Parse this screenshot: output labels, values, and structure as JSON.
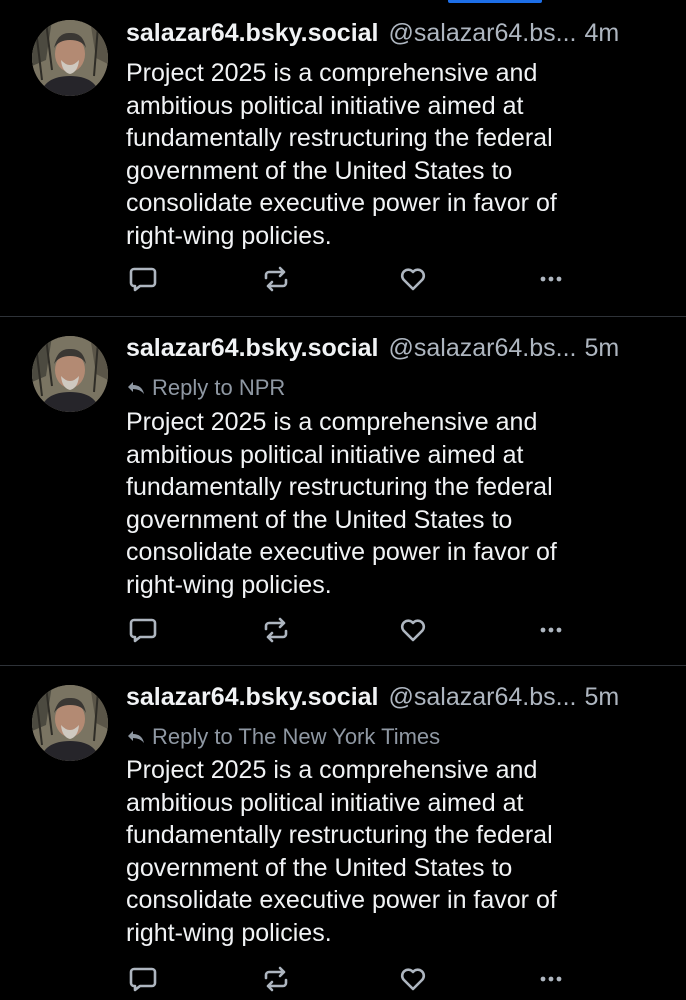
{
  "theme": {
    "background": "#000000",
    "text": "#f1f3f5",
    "muted": "#aeb6c0",
    "divider": "#2e3238",
    "accent": "#1d6fe8"
  },
  "icons": {
    "reply": "speech-bubble-icon",
    "repost": "repost-arrows-icon",
    "like": "heart-icon",
    "more": "ellipsis-icon",
    "reply_to": "reply-arrow-icon"
  },
  "feed": {
    "posts": [
      {
        "display_name": "salazar64.bsky.social",
        "handle": "@salazar64.bs...",
        "time": "4m",
        "reply_to": null,
        "text": "Project 2025 is a comprehensive and\nambitious political initiative aimed at\nfundamentally restructuring the federal\ngovernment of the United States to\nconsolidate executive power in favor of\nright-wing policies."
      },
      {
        "display_name": "salazar64.bsky.social",
        "handle": "@salazar64.bs...",
        "time": "5m",
        "reply_to": "Reply to NPR",
        "text": "Project 2025 is a comprehensive and\nambitious political initiative aimed at\nfundamentally restructuring the federal\ngovernment of the United States to\nconsolidate executive power in favor of\nright-wing policies."
      },
      {
        "display_name": "salazar64.bsky.social",
        "handle": "@salazar64.bs...",
        "time": "5m",
        "reply_to": "Reply to The New York Times",
        "text": "Project 2025 is a comprehensive and\nambitious political initiative aimed at\nfundamentally restructuring the federal\ngovernment of the United States to\nconsolidate executive power in favor of\nright-wing policies."
      }
    ]
  }
}
